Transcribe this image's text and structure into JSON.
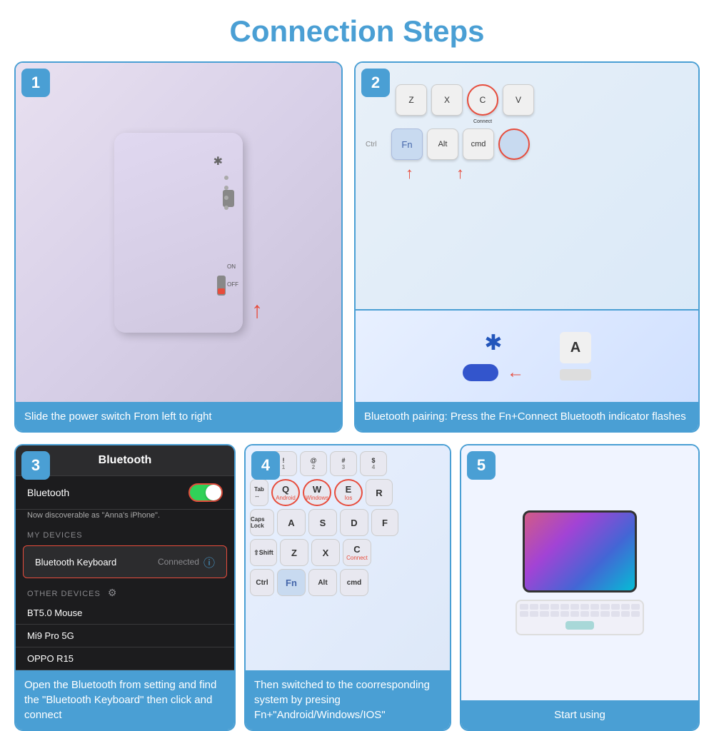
{
  "page": {
    "title": "Connection Steps",
    "steps": [
      {
        "number": "1",
        "caption": "Slide the power switch\nFrom left to right"
      },
      {
        "number": "2",
        "caption": "Bluetooth pairing: Press the Fn+Connect\nBluetooth indicator flashes"
      },
      {
        "number": "3",
        "caption": "Open the Bluetooth from setting and find the \"Bluetooth Keyboard\" then click and connect"
      },
      {
        "number": "4",
        "caption": "Then switched to the coorresponding system by presing Fn+\"Android/Windows/IOS\""
      },
      {
        "number": "5",
        "caption": "Start using"
      }
    ],
    "phone_screen": {
      "title": "Bluetooth",
      "bt_label": "Bluetooth",
      "discoverable": "Now discoverable as \"Anna's iPhone\".",
      "my_devices": "MY DEVICES",
      "device_name": "Bluetooth Keyboard",
      "connected": "Connected",
      "other_devices": "OTHER DEVICES",
      "device1": "BT5.0 Mouse",
      "device2": "Mi9 Pro 5G",
      "device3": "OPPO R15"
    },
    "keyboard_keys": {
      "row1": [
        "Z",
        "X",
        "C",
        "V"
      ],
      "row1_labels": [
        "",
        "",
        "Connect",
        ""
      ],
      "row2": [
        "Fn",
        "Alt",
        "cmd",
        ""
      ],
      "row3": [
        "Android",
        "Windows",
        "Ios"
      ]
    }
  }
}
